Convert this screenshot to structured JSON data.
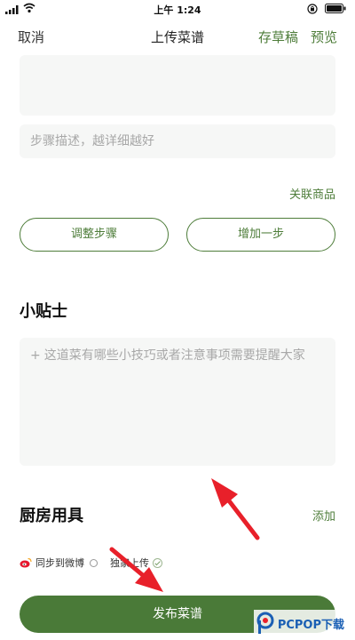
{
  "status_bar": {
    "time": "上午 1:24"
  },
  "nav": {
    "cancel": "取消",
    "title": "上传菜谱",
    "save_draft": "存草稿",
    "preview": "预览"
  },
  "step": {
    "description_placeholder": "步骤描述，越详细越好",
    "link_goods": "关联商品",
    "adjust_steps": "调整步骤",
    "add_step": "增加一步"
  },
  "tips": {
    "heading": "小贴士",
    "plus": "+",
    "placeholder": "这道菜有哪些小技巧或者注意事项需要提醒大家"
  },
  "kitchenware": {
    "heading": "厨房用具",
    "add": "添加"
  },
  "publish_options": {
    "sync_weibo": "同步到微博",
    "exclusive_upload": "独家上传"
  },
  "publish_button": "发布菜谱",
  "watermark": {
    "text": "PCPOP下载"
  },
  "colors": {
    "accent": "#4e7d3a",
    "publish_bg": "#4a7a38",
    "field_bg": "#f6f7f6",
    "arrow": "#e8202a"
  }
}
